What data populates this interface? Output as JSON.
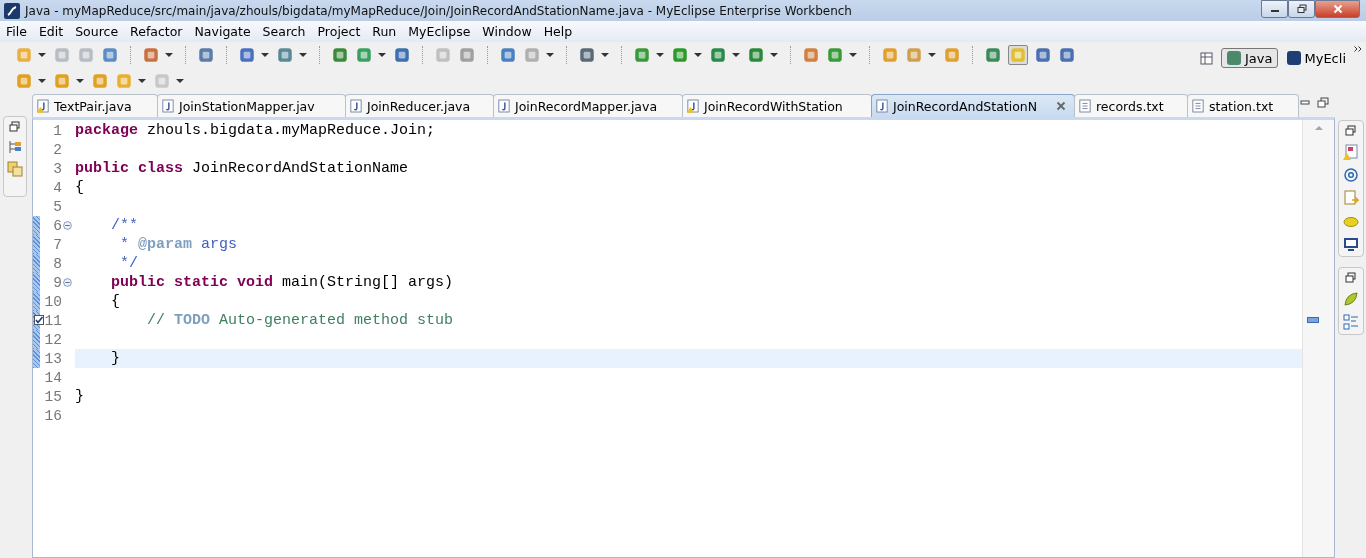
{
  "window": {
    "title": "Java - myMapReduce/src/main/java/zhouls/bigdata/myMapReduce/Join/JoinRecordAndStationName.java - MyEclipse Enterprise Workbench"
  },
  "menu": [
    "File",
    "Edit",
    "Source",
    "Refactor",
    "Navigate",
    "Search",
    "Project",
    "Run",
    "MyEclipse",
    "Window",
    "Help"
  ],
  "perspectives": [
    {
      "label": "Java",
      "selected": true
    },
    {
      "label": "MyEcli",
      "selected": false
    }
  ],
  "tabs": [
    {
      "label": "TextPair.java",
      "kind": "java",
      "warning": true,
      "selected": false
    },
    {
      "label": "JoinStationMapper.jav",
      "kind": "java",
      "warning": false,
      "selected": false
    },
    {
      "label": "JoinReducer.java",
      "kind": "java",
      "warning": false,
      "selected": false
    },
    {
      "label": "JoinRecordMapper.java",
      "kind": "java",
      "warning": false,
      "selected": false
    },
    {
      "label": "JoinRecordWithStation",
      "kind": "java",
      "warning": true,
      "selected": false
    },
    {
      "label": "JoinRecordAndStationN",
      "kind": "java",
      "warning": false,
      "selected": true
    },
    {
      "label": "records.txt",
      "kind": "text",
      "warning": false,
      "selected": false
    },
    {
      "label": "station.txt",
      "kind": "text",
      "warning": false,
      "selected": false
    }
  ],
  "editor": {
    "lines": [
      {
        "number": "1",
        "fold": false,
        "changed": false,
        "task": false,
        "current": false,
        "tokens": [
          {
            "kind": "keyword",
            "text": "package"
          },
          {
            "kind": "plain",
            "text": " zhouls.bigdata.myMapReduce.Join;"
          }
        ]
      },
      {
        "number": "2",
        "fold": false,
        "changed": false,
        "task": false,
        "current": false
      },
      {
        "number": "3",
        "fold": false,
        "changed": false,
        "task": false,
        "current": false,
        "tokens": [
          {
            "kind": "keyword",
            "text": "public class"
          },
          {
            "kind": "plain",
            "text": " JoinRecordAndStationName"
          }
        ]
      },
      {
        "number": "4",
        "fold": false,
        "changed": false,
        "task": false,
        "current": false,
        "tokens": [
          {
            "kind": "plain",
            "text": "{"
          }
        ]
      },
      {
        "number": "5",
        "fold": false,
        "changed": false,
        "task": false,
        "current": false
      },
      {
        "number": "6",
        "fold": true,
        "changed": true,
        "task": false,
        "current": false,
        "tokens": [
          {
            "kind": "javadoc",
            "text": "    /**"
          }
        ]
      },
      {
        "number": "7",
        "fold": false,
        "changed": true,
        "task": false,
        "current": false,
        "tokens": [
          {
            "kind": "javadoc",
            "text": "     * "
          },
          {
            "kind": "tag",
            "text": "@param"
          },
          {
            "kind": "javadoc",
            "text": " args"
          }
        ]
      },
      {
        "number": "8",
        "fold": false,
        "changed": true,
        "task": false,
        "current": false,
        "tokens": [
          {
            "kind": "javadoc",
            "text": "     */"
          }
        ]
      },
      {
        "number": "9",
        "fold": true,
        "changed": true,
        "task": false,
        "current": false,
        "tokens": [
          {
            "kind": "keyword",
            "text": "    public static void"
          },
          {
            "kind": "plain",
            "text": " main(String[] args)"
          }
        ]
      },
      {
        "number": "10",
        "fold": false,
        "changed": true,
        "task": false,
        "current": false,
        "tokens": [
          {
            "kind": "plain",
            "text": "    {"
          }
        ]
      },
      {
        "number": "11",
        "fold": false,
        "changed": true,
        "task": true,
        "current": false,
        "tokens": [
          {
            "kind": "comment",
            "text": "        // "
          },
          {
            "kind": "tag",
            "text": "TODO"
          },
          {
            "kind": "comment",
            "text": " Auto-generated method stub"
          }
        ]
      },
      {
        "number": "12",
        "fold": false,
        "changed": true,
        "task": false,
        "current": false
      },
      {
        "number": "13",
        "fold": false,
        "changed": true,
        "task": false,
        "current": true,
        "tokens": [
          {
            "kind": "plain",
            "text": "    }"
          }
        ]
      },
      {
        "number": "14",
        "fold": false,
        "changed": false,
        "task": false,
        "current": false
      },
      {
        "number": "15",
        "fold": false,
        "changed": false,
        "task": false,
        "current": false,
        "tokens": [
          {
            "kind": "plain",
            "text": "}"
          }
        ]
      },
      {
        "number": "16",
        "fold": false,
        "changed": false,
        "task": false,
        "current": false
      }
    ]
  }
}
